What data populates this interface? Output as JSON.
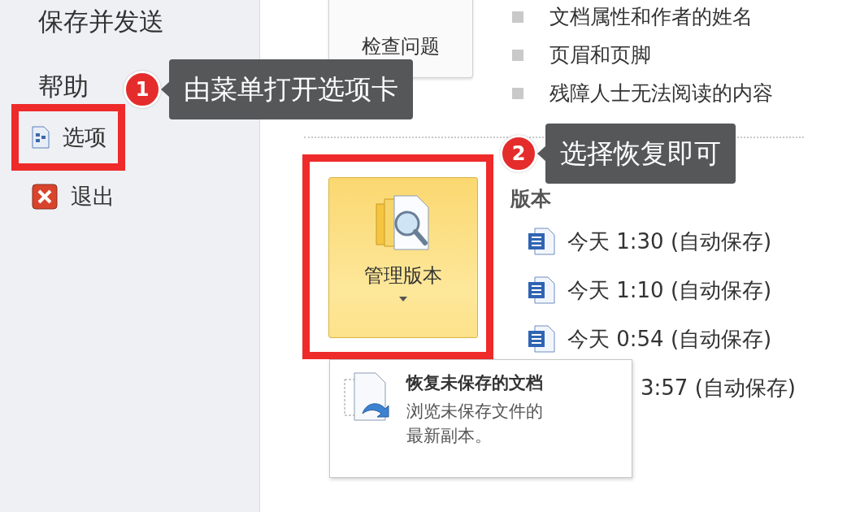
{
  "sidebar": {
    "items": [
      {
        "kind": "heading",
        "label": "保存并发送",
        "highlighted": false
      },
      {
        "kind": "heading",
        "label": "帮助",
        "highlighted": false
      },
      {
        "kind": "options",
        "label": "选项",
        "highlighted": true
      },
      {
        "kind": "exit",
        "label": "退出",
        "highlighted": false
      }
    ]
  },
  "inspect": {
    "button": "检查问题",
    "bullets": [
      "文档属性和作者的姓名",
      "页眉和页脚",
      "残障人士无法阅读的内容"
    ]
  },
  "versions": {
    "button": "管理版本",
    "highlighted": true,
    "heading": "版本",
    "items": [
      {
        "label": "今天 1:30 (自动保存)",
        "icon": true
      },
      {
        "label": "今天 1:10 (自动保存)",
        "icon": true
      },
      {
        "label": "今天 0:54 (自动保存)",
        "icon": true
      },
      {
        "label": "3:57 (自动保存)",
        "icon": false
      }
    ]
  },
  "menu": {
    "title": "恢复未保存的文档",
    "description": "浏览未保存文件的最新副本。"
  },
  "callouts": [
    {
      "number": "1",
      "text": "由菜单打开选项卡"
    },
    {
      "number": "2",
      "text": "选择恢复即可"
    }
  ]
}
